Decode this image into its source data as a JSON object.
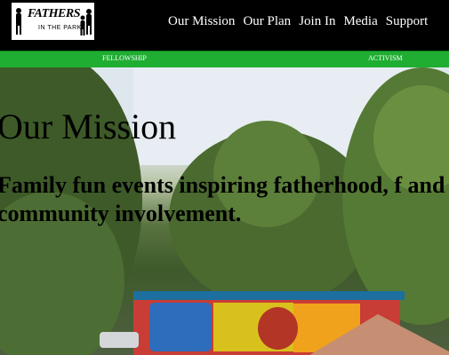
{
  "logo": {
    "line1": "FATHERS",
    "line2": "IN THE PARK"
  },
  "nav": {
    "items": [
      "Our Mission",
      "Our Plan",
      "Join In",
      "Media",
      "Support"
    ]
  },
  "subnav": {
    "items": [
      "FELLOWSHIP",
      "ACTIVISM"
    ]
  },
  "hero": {
    "title": "Our Mission",
    "subtitle": "Family fun events inspiring fatherhood, f and community involvement."
  },
  "colors": {
    "header_bg": "#000000",
    "nav_text": "#ffffff",
    "subbar_bg": "#1fae32",
    "hero_text": "#000000"
  }
}
